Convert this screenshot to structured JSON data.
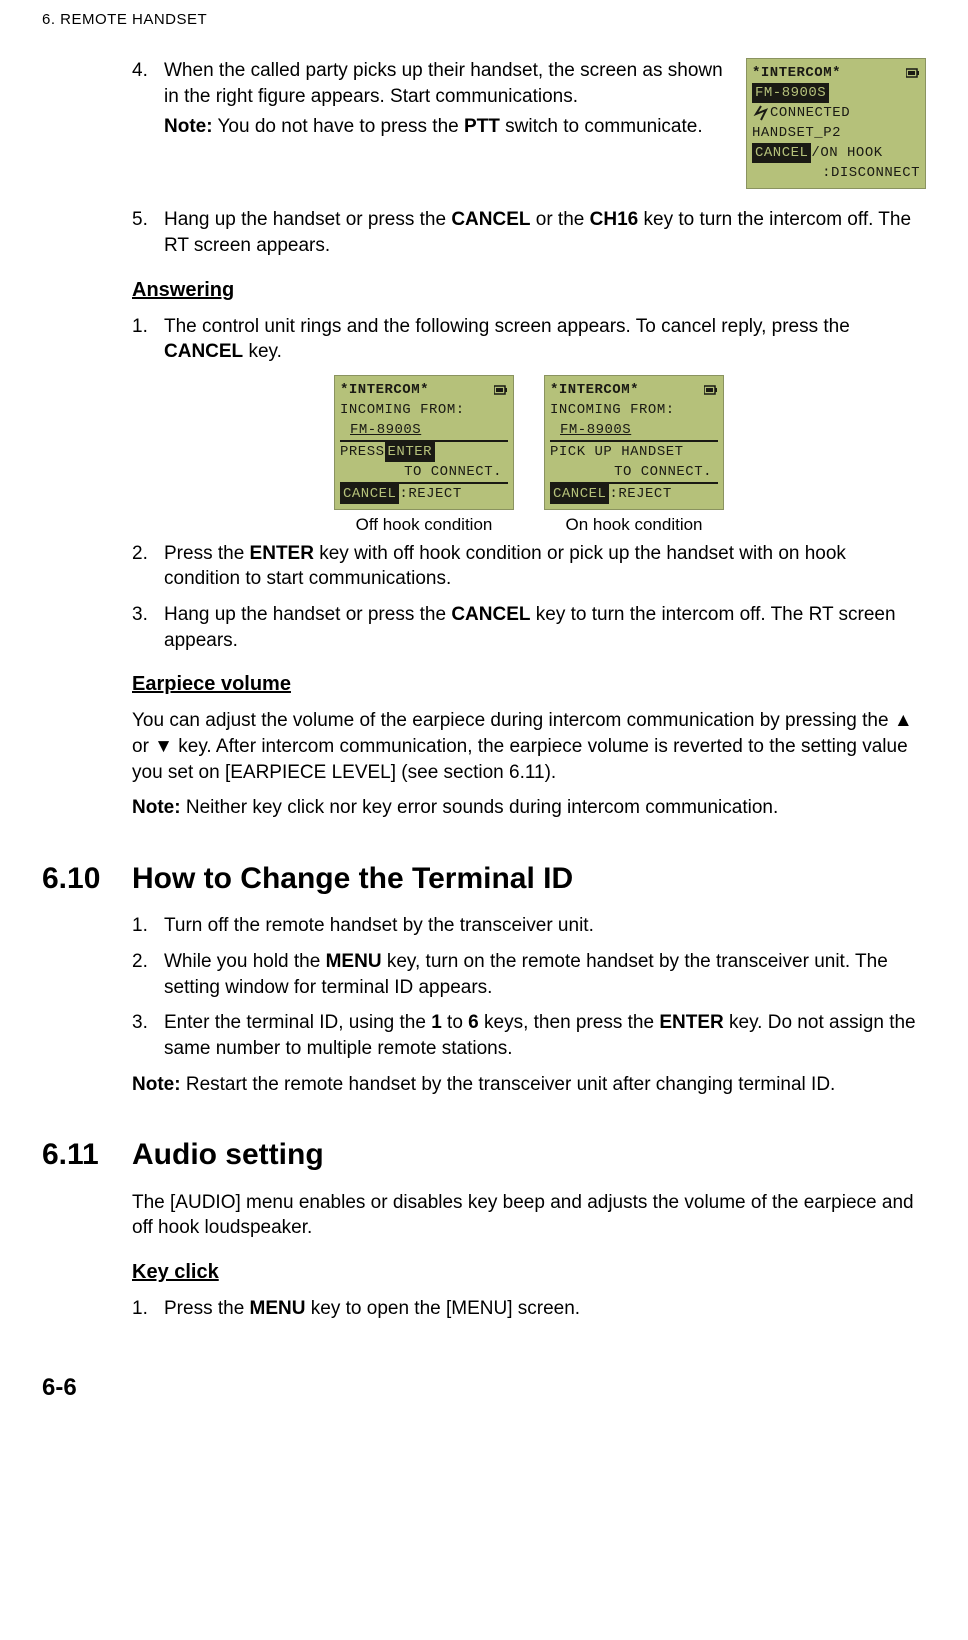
{
  "header": "6.  REMOTE HANDSET",
  "step4": {
    "num": "4.",
    "text_a": "When the called party picks up their handset, the screen as shown in the right figure appears. Start communications.",
    "note_label": "Note:",
    "note_text_a": " You do not have to press the ",
    "note_bold": "PTT",
    "note_text_b": " switch to communicate."
  },
  "lcd_connected": {
    "title": "*INTERCOM*",
    "line1": "FM-8900S",
    "line2": "CONNECTED",
    "line3": "HANDSET_P2",
    "foot_inv": "CANCEL",
    "foot_rest": "/ON HOOK",
    "foot2": ":DISCONNECT"
  },
  "step5": {
    "num": "5.",
    "a": "Hang up the handset or press the ",
    "b1": "CANCEL",
    "mid": " or the ",
    "b2": "CH16",
    "c": " key to turn the intercom off. The RT screen appears."
  },
  "answering_heading": "Answering",
  "ans1": {
    "num": "1.",
    "a": "The control unit rings and the following screen appears. To cancel reply, press the ",
    "b": "CANCEL",
    "c": " key."
  },
  "lcd_off": {
    "title": "*INTERCOM*",
    "l1": "INCOMING FROM:",
    "l2": "FM-8900S",
    "l3a": "PRESS ",
    "l3b": "ENTER",
    "l4": "TO CONNECT.",
    "foot_inv": "CANCEL",
    "foot_rest": " :REJECT",
    "caption": "Off hook condition"
  },
  "lcd_on": {
    "title": "*INTERCOM*",
    "l1": "INCOMING FROM:",
    "l2": "FM-8900S",
    "l3": "PICK UP HANDSET",
    "l4": "TO CONNECT.",
    "foot_inv": "CANCEL",
    "foot_rest": " :REJECT",
    "caption": "On hook condition"
  },
  "ans2": {
    "num": "2.",
    "a": "Press the ",
    "b": "ENTER",
    "c": " key with off hook condition or pick up the handset with on hook condition to start communications."
  },
  "ans3": {
    "num": "3.",
    "a": "Hang up the handset or press the ",
    "b": "CANCEL",
    "c": " key to turn the intercom off. The RT screen appears."
  },
  "earpiece_heading": "Earpiece volume",
  "earpiece_para": "You can adjust the volume of the earpiece during intercom communication by pressing the ▲ or ▼ key. After intercom communication, the earpiece volume is reverted to the setting value you set on [EARPIECE LEVEL] (see section 6.11).",
  "earpiece_note_label": "Note:",
  "earpiece_note_text": " Neither key click nor key error sounds during intercom communication.",
  "s610": {
    "num": "6.10",
    "title": "How to Change the Terminal ID",
    "step1": {
      "num": "1.",
      "text": "Turn off the remote handset by the transceiver unit."
    },
    "step2": {
      "num": "2.",
      "a": "While you hold the ",
      "b": "MENU",
      "c": " key, turn on the remote handset by the transceiver unit. The setting window for terminal ID appears."
    },
    "step3": {
      "num": "3.",
      "a": "Enter the terminal ID, using the ",
      "b1": "1",
      "mid1": " to ",
      "b2": "6",
      "mid2": " keys, then press the ",
      "b3": "ENTER",
      "c": " key. Do not assign the same number to multiple remote stations."
    },
    "note_label": "Note:",
    "note_text": " Restart the remote handset by the transceiver unit after changing terminal ID."
  },
  "s611": {
    "num": "6.11",
    "title": "Audio setting",
    "intro": "The [AUDIO] menu enables or disables key beep and adjusts the volume of the earpiece and off hook loudspeaker.",
    "keyclick_heading": "Key click",
    "step1": {
      "num": "1.",
      "a": "Press the ",
      "b": "MENU",
      "c": " key to open the [MENU] screen."
    }
  },
  "page_number": "6-6"
}
